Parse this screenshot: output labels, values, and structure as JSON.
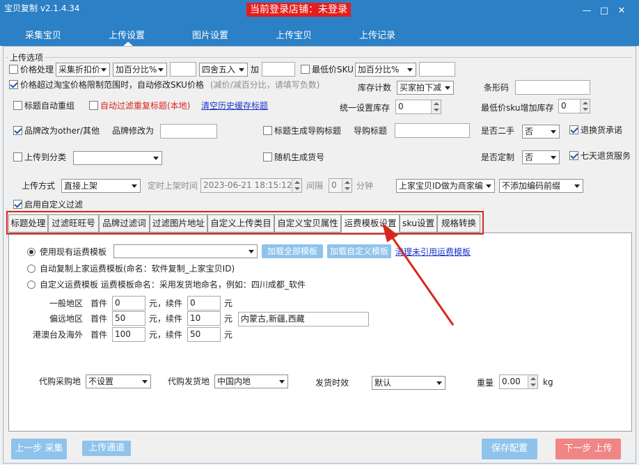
{
  "app": {
    "title": "宝贝复制 v2.1.4.34",
    "login_status": "当前登录店铺：未登录"
  },
  "window": {
    "minimize": "—",
    "maximize": "□",
    "close": "✕"
  },
  "nav": {
    "tabs": [
      "采集宝贝",
      "上传设置",
      "图片设置",
      "上传宝贝",
      "上传记录"
    ],
    "active": "上传设置"
  },
  "upload_options": {
    "group_title": "上传选项",
    "price_process": {
      "label": "价格处理",
      "mode": "采集折扣价",
      "method": "加百分比%",
      "value": "",
      "rounding": "四舍五入",
      "add_label": "加",
      "add_value": ""
    },
    "min_sku": {
      "label": "最低价SKU",
      "method": "加百分比%",
      "value": ""
    },
    "auto_modify_sku": {
      "label": "价格超过淘宝价格限制范围时，自动修改SKU价格",
      "hint": "(减价/减百分比，请填写负数)"
    },
    "stock_count": {
      "label": "库存计数",
      "value": "买家拍下减"
    },
    "barcode": {
      "label": "条形码",
      "value": ""
    },
    "title_regroup": {
      "label": "标题自动重组"
    },
    "filter_repeat_title": {
      "label": "自动过滤重复标题(本地)"
    },
    "clear_history_link": "清空历史缓存标题",
    "unify_stock": {
      "label": "统一设置库存",
      "value": "0"
    },
    "min_sku_stock": {
      "label": "最低价sku增加库存",
      "value": "0"
    },
    "brand_other": {
      "label": "品牌改为other/其他"
    },
    "brand_modify": {
      "label": "品牌修改为",
      "value": ""
    },
    "guide_title_gen": {
      "label": "标题生成导购标题"
    },
    "guide_title": {
      "label": "导购标题",
      "value": ""
    },
    "second_hand": {
      "label": "是否二手",
      "value": "否"
    },
    "return_commit": {
      "label": "退换货承诺"
    },
    "upload_category": {
      "label": "上传到分类",
      "value": ""
    },
    "random_sku_no": {
      "label": "随机生成货号"
    },
    "customized": {
      "label": "是否定制",
      "value": "否"
    },
    "seven_day_return": {
      "label": "七天退货服务"
    },
    "upload_mode": {
      "label": "上传方式",
      "value": "直接上架"
    },
    "timed_upload": {
      "label": "定时上架时间",
      "value": "2023-06-21 18:15:12",
      "interval_label": "间隔",
      "interval_value": "0",
      "unit": "分钟"
    },
    "merchant_code": {
      "value": "上家宝贝ID做为商家编"
    },
    "code_prefix": {
      "value": "不添加编码前缀"
    },
    "custom_filter": {
      "label": "启用自定义过滤"
    }
  },
  "tabs": [
    "标题处理",
    "过滤旺旺号",
    "品牌过滤词",
    "过滤图片地址",
    "自定义上传类目",
    "自定义宝贝属性",
    "运费模板设置",
    "sku设置",
    "规格转换"
  ],
  "active_tab": "运费模板设置",
  "freight": {
    "use_existing": {
      "label": "使用现有运费模板",
      "value": ""
    },
    "load_all_button": "加载全部模板",
    "load_custom_button": "加载自定义模板",
    "clean_unused_link": "清理未引用运费模板",
    "auto_copy": {
      "label": "自动复制上家运费模板(命名：软件复制_上家宝贝ID)"
    },
    "custom": {
      "label": "自定义运费模板 运费模板命名：采用发货地命名，例如：四川成都_软件"
    },
    "regions": [
      {
        "name": "一般地区",
        "first_label": "首件",
        "first": "0",
        "yuan1": "元，续件",
        "next": "0",
        "yuan2": "元",
        "extra": ""
      },
      {
        "name": "偏远地区",
        "first_label": "首件",
        "first": "50",
        "yuan1": "元，续件",
        "next": "10",
        "yuan2": "元",
        "extra": "内蒙古,新疆,西藏"
      },
      {
        "name": "港澳台及海外",
        "first_label": "首件",
        "first": "100",
        "yuan1": "元，续件",
        "next": "50",
        "yuan2": "元",
        "extra": ""
      }
    ],
    "purchase_place": {
      "label": "代购采购地",
      "value": "不设置"
    },
    "ship_place": {
      "label": "代购发货地",
      "value": "中国内地"
    },
    "ship_time": {
      "label": "发货时效",
      "value": "默认"
    },
    "weight": {
      "label": "重量",
      "value": "0.00",
      "unit": "kg"
    }
  },
  "footer": {
    "prev": "上一步 采集",
    "channel": "上传通道",
    "save": "保存配置",
    "next": "下一步 上传"
  },
  "colors": {
    "title_bar": "#2b80c6",
    "highlight_red": "#d8261c",
    "light_blue_button": "#8ec3ec",
    "next_button": "#f08585"
  }
}
